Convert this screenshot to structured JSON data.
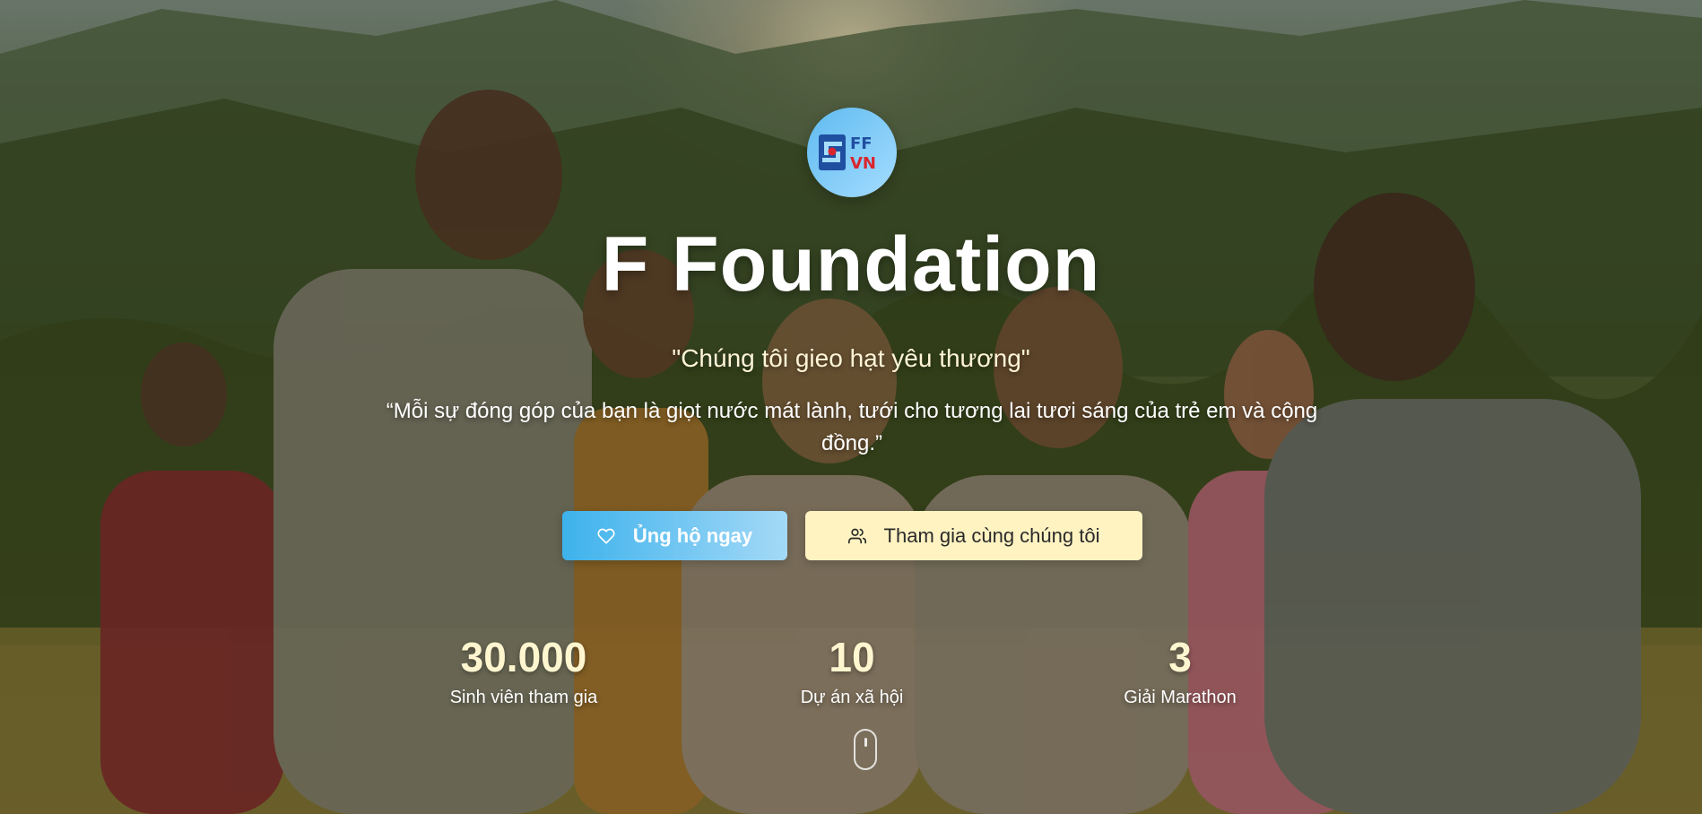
{
  "hero": {
    "logo": {
      "line1": "FF",
      "line2": "VN",
      "accent_red": "#d9262e",
      "accent_blue": "#1f4fa0"
    },
    "title": "F Foundation",
    "tagline": "\"Chúng tôi gieo hạt yêu thương\"",
    "quote": "“Mỗi sự đóng góp của bạn là giọt nước mát lành, tưới cho tương lai tươi sáng của trẻ em và cộng đồng.”"
  },
  "actions": {
    "donate": {
      "label": "Ủng hộ ngay",
      "icon": "heart-icon"
    },
    "join": {
      "label": "Tham gia cùng chúng tôi",
      "icon": "users-icon"
    }
  },
  "stats": [
    {
      "value": "30.000",
      "label": "Sinh viên tham gia"
    },
    {
      "value": "10",
      "label": "Dự án xã hội"
    },
    {
      "value": "3",
      "label": "Giải Marathon"
    }
  ],
  "colors": {
    "primary_blue": "#3db2ec",
    "cream": "#fff3c2",
    "stat_value": "#fff6d0"
  },
  "scroll_indicator": {
    "icon": "mouse-scroll-icon"
  }
}
